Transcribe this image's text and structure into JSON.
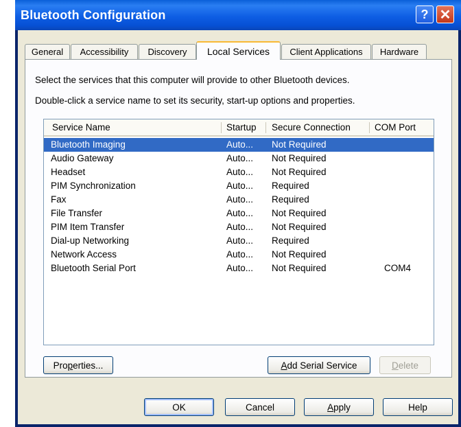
{
  "window": {
    "title": "Bluetooth Configuration",
    "help_glyph": "?",
    "close_glyph": "✕"
  },
  "tabs": [
    "General",
    "Accessibility",
    "Discovery",
    "Local Services",
    "Client Applications",
    "Hardware"
  ],
  "active_tab": "Local Services",
  "description": {
    "line1": "Select the services that this computer will provide to other Bluetooth devices.",
    "line2": "Double-click a service name to set its security, start-up options and properties."
  },
  "table": {
    "columns": [
      "Service Name",
      "Startup",
      "Secure Connection",
      "COM Port"
    ],
    "rows": [
      [
        "Bluetooth Imaging",
        "Auto...",
        "Not Required",
        ""
      ],
      [
        "Audio Gateway",
        "Auto...",
        "Not Required",
        ""
      ],
      [
        "Headset",
        "Auto...",
        "Not Required",
        ""
      ],
      [
        "PIM Synchronization",
        "Auto...",
        "Required",
        ""
      ],
      [
        "Fax",
        "Auto...",
        "Required",
        ""
      ],
      [
        "File Transfer",
        "Auto...",
        "Not Required",
        ""
      ],
      [
        "PIM Item Transfer",
        "Auto...",
        "Not Required",
        ""
      ],
      [
        "Dial-up Networking",
        "Auto...",
        "Required",
        ""
      ],
      [
        "Network Access",
        "Auto...",
        "Not Required",
        ""
      ],
      [
        "Bluetooth Serial Port",
        "Auto...",
        "Not Required",
        "COM4"
      ]
    ],
    "selected_row": 0
  },
  "panel_buttons": {
    "properties": {
      "pre": "Pro",
      "key": "p",
      "post": "erties..."
    },
    "add_serial": {
      "pre": "",
      "key": "A",
      "post": "dd Serial Service"
    },
    "delete": {
      "pre": "",
      "key": "D",
      "post": "elete"
    }
  },
  "footer_buttons": {
    "ok": "OK",
    "cancel": "Cancel",
    "apply": {
      "pre": "",
      "key": "A",
      "post": "pply"
    },
    "help": "Help"
  },
  "colors": {
    "selection": "#316ac5",
    "titlebar": "#0a5fd8",
    "tab_accent": "#f9b934",
    "face": "#ece9d8"
  }
}
